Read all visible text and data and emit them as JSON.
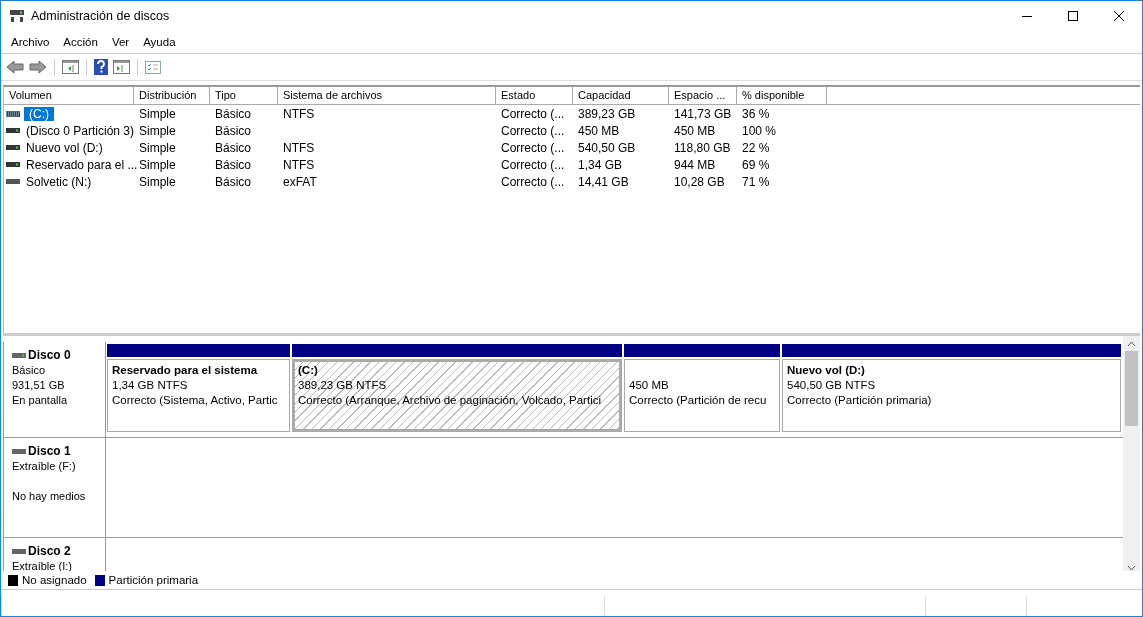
{
  "window": {
    "title": "Administración de discos"
  },
  "menu": [
    "Archivo",
    "Acción",
    "Ver",
    "Ayuda"
  ],
  "volumes": {
    "columns": [
      "Volumen",
      "Distribución",
      "Tipo",
      "Sistema de archivos",
      "Estado",
      "Capacidad",
      "Espacio ...",
      "% disponible"
    ],
    "rows": [
      {
        "selected": true,
        "kind": "striped",
        "cells": [
          "(C:)",
          "Simple",
          "Básico",
          "NTFS",
          "Correcto (...",
          "389,23 GB",
          "141,73 GB",
          "36 %"
        ]
      },
      {
        "selected": false,
        "kind": "drive",
        "cells": [
          "(Disco 0 Partición 3)",
          "Simple",
          "Básico",
          "",
          "Correcto (...",
          "450 MB",
          "450 MB",
          "100 %"
        ]
      },
      {
        "selected": false,
        "kind": "drive",
        "cells": [
          "Nuevo vol (D:)",
          "Simple",
          "Básico",
          "NTFS",
          "Correcto (...",
          "540,50 GB",
          "118,80 GB",
          "22 %"
        ]
      },
      {
        "selected": false,
        "kind": "drive",
        "cells": [
          "Reservado para el ...",
          "Simple",
          "Básico",
          "NTFS",
          "Correcto (...",
          "1,34 GB",
          "944 MB",
          "69 %"
        ]
      },
      {
        "selected": false,
        "kind": "removable",
        "cells": [
          "Solvetic (N:)",
          "Simple",
          "Básico",
          "exFAT",
          "Correcto (...",
          "14,41 GB",
          "10,28 GB",
          "71 %"
        ]
      }
    ]
  },
  "disks": [
    {
      "name": "Disco 0",
      "lines": [
        "Básico",
        "931,51 GB"
      ],
      "status": "En pantalla",
      "partitions": [
        {
          "name": "Reservado para el sistema",
          "size": "1,34 GB NTFS",
          "status": "Correcto (Sistema, Activo, Partic",
          "selected": false,
          "color": "#000080"
        },
        {
          "name": "(C:)",
          "size": "389,23 GB NTFS",
          "status": "Correcto (Arranque, Archivo de paginación, Volcado, Partici",
          "selected": true,
          "color": "#000080"
        },
        {
          "size": "450 MB",
          "status": "Correcto (Partición de recu",
          "selected": false,
          "color": "#000080"
        },
        {
          "name": "Nuevo vol  (D:)",
          "size": "540,50 GB NTFS",
          "status": "Correcto (Partición primaria)",
          "selected": false,
          "color": "#000080"
        }
      ]
    },
    {
      "name": "Disco 1",
      "lines": [
        "Extraíble (F:)"
      ],
      "status": "No hay medios"
    },
    {
      "name": "Disco 2",
      "lines": [
        "Extraíble (I:)"
      ]
    }
  ],
  "legend": [
    {
      "label": "No asignado",
      "color": "#000000"
    },
    {
      "label": "Partición primaria",
      "color": "#000080"
    }
  ]
}
